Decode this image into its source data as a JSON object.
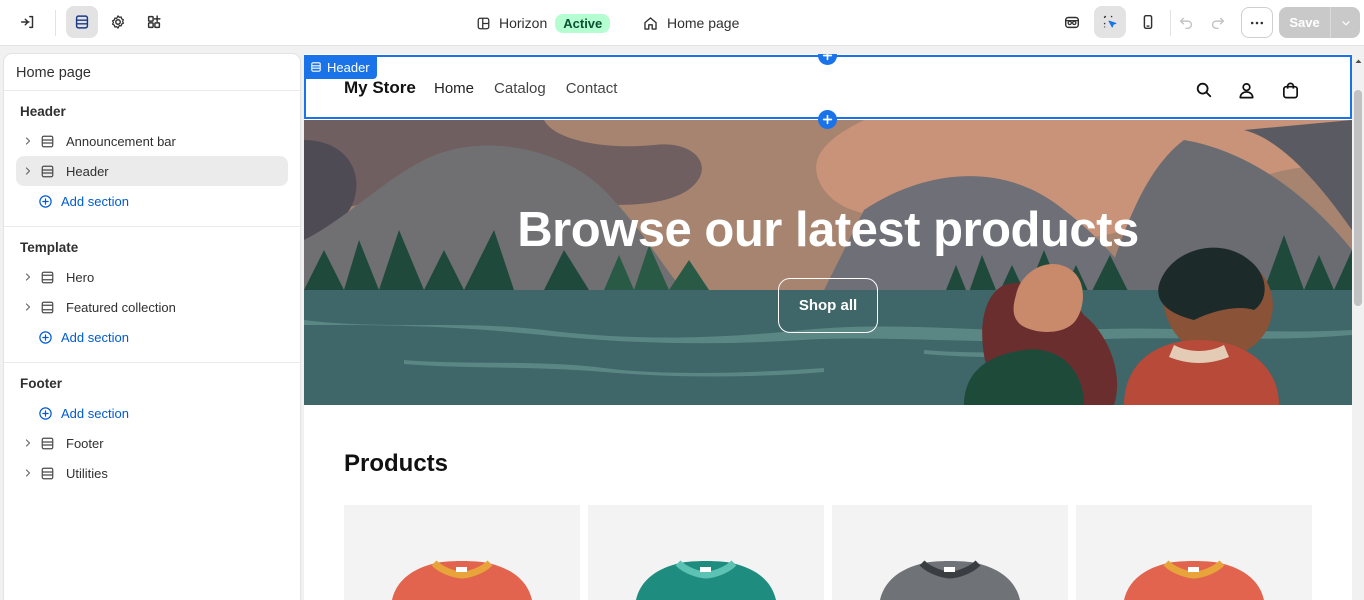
{
  "topbar": {
    "theme_name": "Horizon",
    "theme_status": "Active",
    "page_name": "Home page",
    "save_label": "Save"
  },
  "sidebar": {
    "title": "Home page",
    "groups": [
      {
        "title": "Header",
        "items": [
          {
            "label": "Announcement bar"
          },
          {
            "label": "Header"
          }
        ],
        "add_label": "Add section"
      },
      {
        "title": "Template",
        "items": [
          {
            "label": "Hero"
          },
          {
            "label": "Featured collection"
          }
        ],
        "add_label": "Add section"
      },
      {
        "title": "Footer",
        "add_label": "Add section",
        "items": [
          {
            "label": "Footer"
          },
          {
            "label": "Utilities"
          }
        ]
      }
    ]
  },
  "preview": {
    "selected_tag": "Header",
    "store_name": "My Store",
    "nav": [
      "Home",
      "Catalog",
      "Contact"
    ],
    "hero_title": "Browse our latest products",
    "hero_button": "Shop all",
    "products_title": "Products"
  },
  "colors": {
    "accent_blue": "#1a73e8",
    "link_blue": "#005bd3",
    "active_badge_bg": "#b4fed2",
    "active_badge_text": "#0c5132"
  }
}
